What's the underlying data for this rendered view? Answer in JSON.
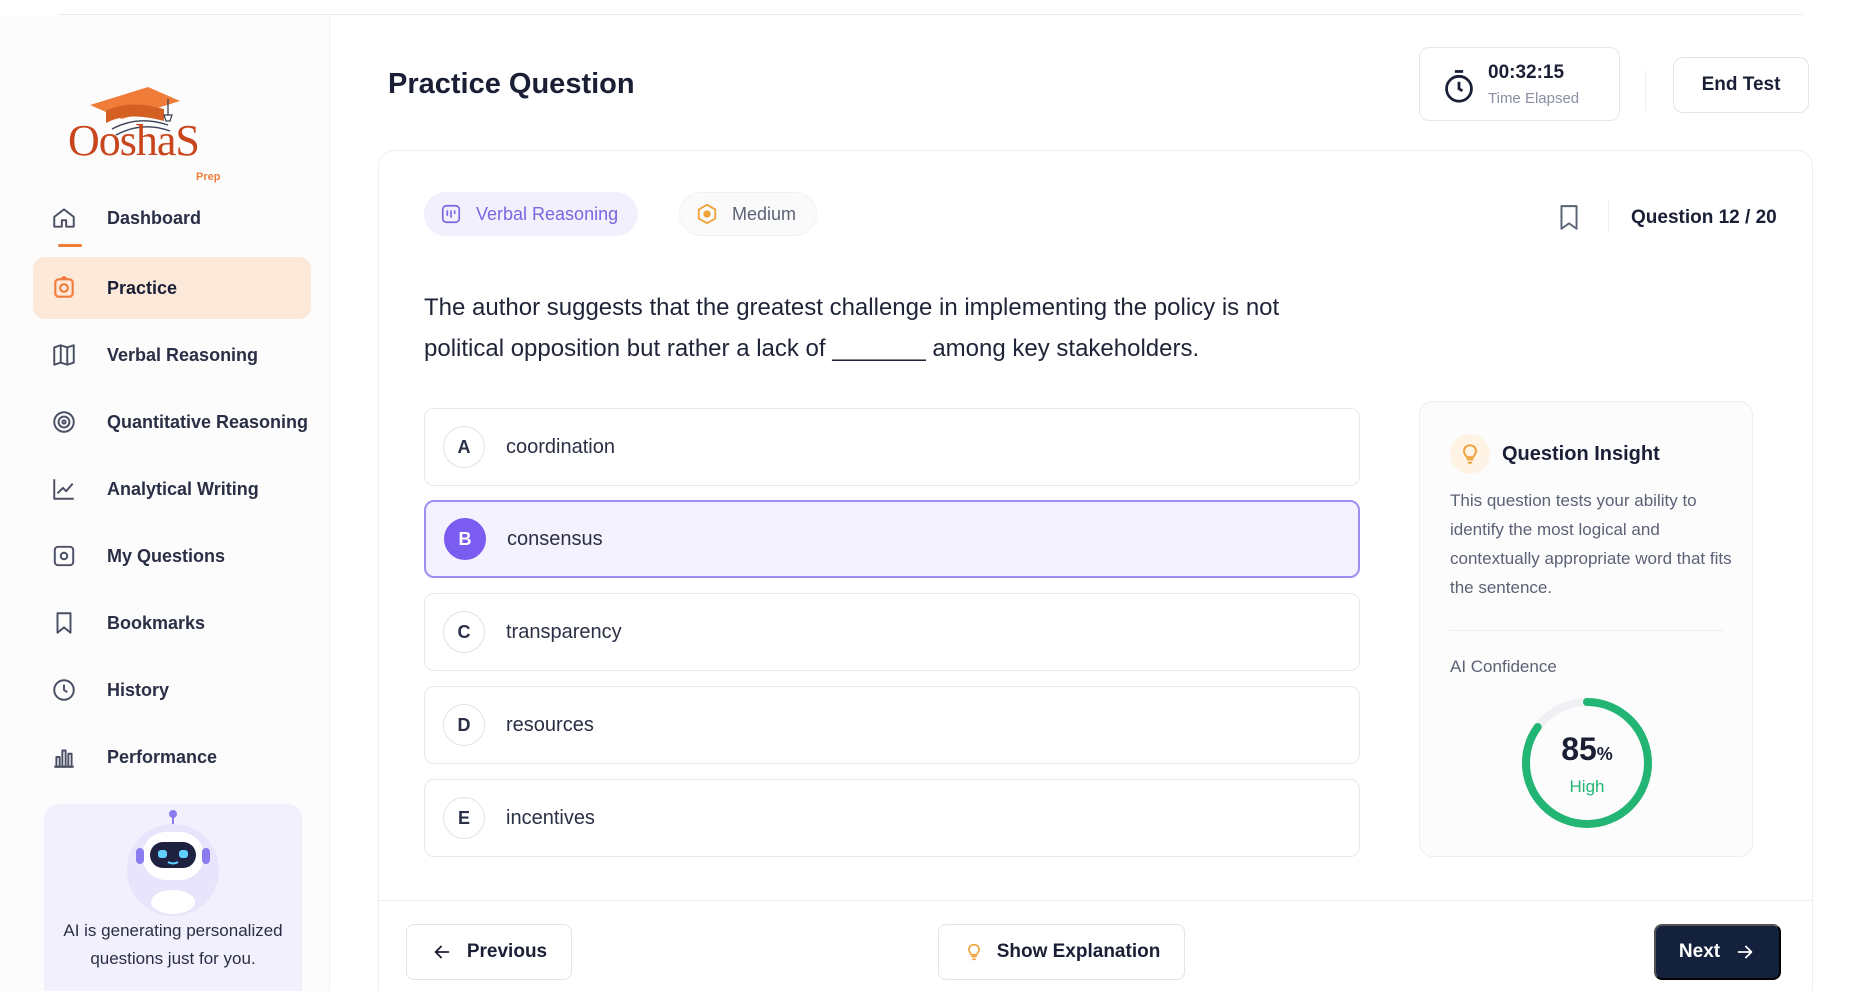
{
  "brand": {
    "name": "OoshaS",
    "tagline": "Prep",
    "accent": "#f07c3a"
  },
  "sidebar": {
    "items": [
      {
        "label": "Dashboard",
        "icon": "home-icon",
        "active": false
      },
      {
        "label": "Practice",
        "icon": "practice-icon",
        "active": true
      },
      {
        "label": "Verbal Reasoning",
        "icon": "book-icon",
        "active": false
      },
      {
        "label": "Quantitative Reasoning",
        "icon": "target-icon",
        "active": false
      },
      {
        "label": "Analytical Writing",
        "icon": "chart-line-icon",
        "active": false
      },
      {
        "label": "My Questions",
        "icon": "question-box-icon",
        "active": false
      },
      {
        "label": "Bookmarks",
        "icon": "bookmark-icon",
        "active": false
      },
      {
        "label": "History",
        "icon": "clock-icon",
        "active": false
      },
      {
        "label": "Performance",
        "icon": "bar-chart-icon",
        "active": false
      }
    ],
    "ai_card": {
      "text": "AI is generating personalized questions just for you."
    }
  },
  "header": {
    "title": "Practice Question",
    "timer": {
      "value": "00:32:15",
      "label": "Time Elapsed"
    },
    "end_button": "End Test"
  },
  "question": {
    "topic": "Verbal Reasoning",
    "difficulty": "Medium",
    "counter": "Question 12 / 20",
    "text": "The author suggests that the greatest challenge in implementing the policy is not political opposition but rather a lack of _______ among key stakeholders.",
    "selected": "B",
    "options": [
      {
        "letter": "A",
        "text": "coordination"
      },
      {
        "letter": "B",
        "text": "consensus"
      },
      {
        "letter": "C",
        "text": "transparency"
      },
      {
        "letter": "D",
        "text": "resources"
      },
      {
        "letter": "E",
        "text": "incentives"
      }
    ]
  },
  "insight": {
    "title": "Question Insight",
    "description": "This question tests your ability to identify the most logical and contextually appropriate word that fits the sentence.",
    "confidence_label": "AI Confidence",
    "confidence_value": "85",
    "confidence_unit": "%",
    "confidence_level": "High",
    "confidence_fraction": 0.85,
    "confidence_color": "#22b573"
  },
  "footer": {
    "previous": "Previous",
    "explanation": "Show Explanation",
    "next": "Next"
  }
}
